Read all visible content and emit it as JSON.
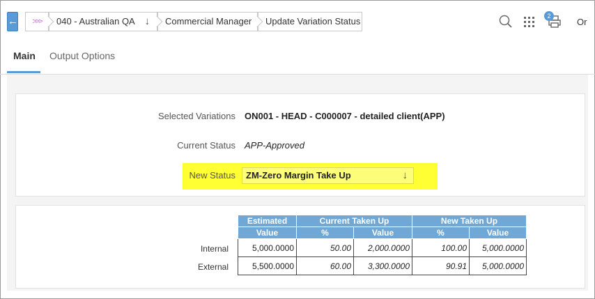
{
  "topbar": {
    "back_glyph": "←",
    "home_glyph": ">>>",
    "breadcrumbs": {
      "company": "040 - Australian QA",
      "module": "Commercial Manager",
      "page": "Update Variation Status"
    },
    "company_arrow": "↓",
    "print_badge": "2",
    "user_text": "Or",
    "icons": [
      "search-icon",
      "apps-grid-icon",
      "print-icon"
    ]
  },
  "tabs": [
    {
      "label": "Main",
      "active": true
    },
    {
      "label": "Output Options",
      "active": false
    }
  ],
  "form": {
    "selected_variations_label": "Selected Variations",
    "selected_variations_value": "ON001 - HEAD - C000007 - detailed client(APP)",
    "current_status_label": "Current Status",
    "current_status_value": "APP-Approved",
    "new_status_label": "New Status",
    "new_status_value": "ZM-Zero Margin Take Up",
    "new_status_arrow": "↓",
    "highlight_color": "#ffff33"
  },
  "table": {
    "group_headers": [
      "Estimated",
      "Current Taken Up",
      "New Taken Up"
    ],
    "sub_headers": [
      "Value",
      "%",
      "Value",
      "%",
      "Value"
    ],
    "rows": [
      {
        "label": "Internal",
        "cells": [
          "5,000.0000",
          "50.00",
          "2,000.0000",
          "100.00",
          "5,000.0000"
        ]
      },
      {
        "label": "External",
        "cells": [
          "5,500.0000",
          "60.00",
          "3,300.0000",
          "90.91",
          "5,000.0000"
        ]
      }
    ],
    "header_color": "#6fa8d6"
  }
}
